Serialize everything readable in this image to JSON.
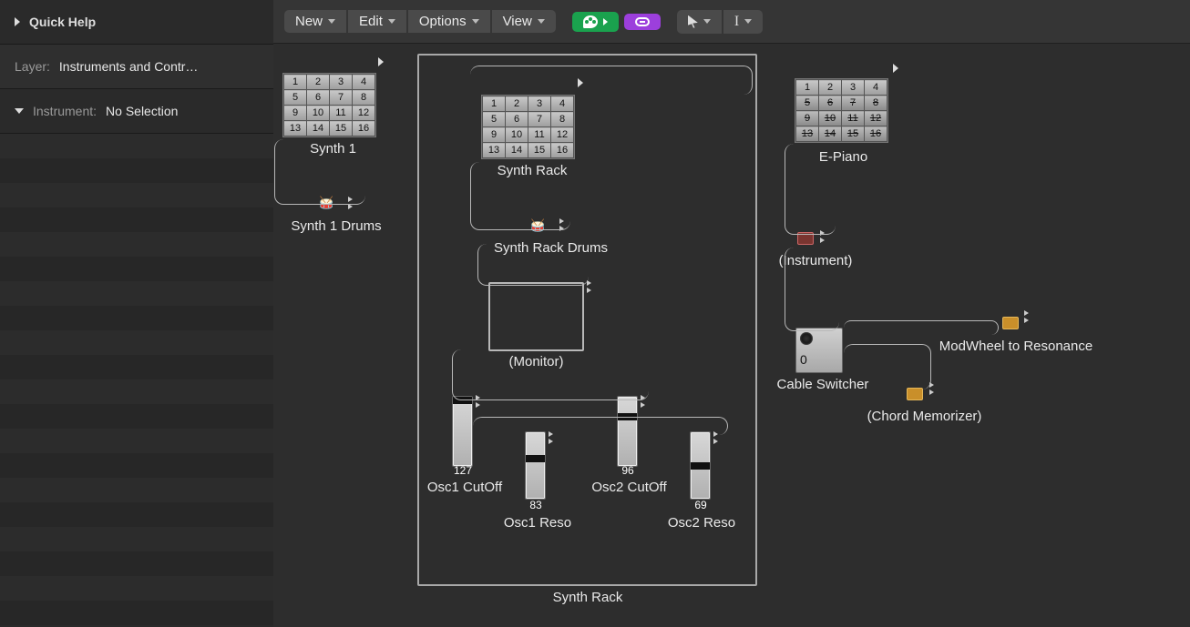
{
  "sidebar": {
    "quick_help_title": "Quick Help",
    "layer_label": "Layer:",
    "layer_value": "Instruments and Contr…",
    "instrument_label": "Instrument:",
    "instrument_value": "No Selection"
  },
  "toolbar": {
    "new": "New",
    "edit": "Edit",
    "options": "Options",
    "view": "View"
  },
  "objects": {
    "synth1": {
      "label": "Synth 1",
      "cells": [
        [
          1,
          2,
          3,
          4
        ],
        [
          5,
          6,
          7,
          8
        ],
        [
          9,
          10,
          11,
          12
        ],
        [
          13,
          14,
          15,
          16
        ]
      ]
    },
    "synth1_drums": {
      "label": "Synth 1 Drums"
    },
    "synth_rack": {
      "label": "Synth Rack",
      "cells": [
        [
          1,
          2,
          3,
          4
        ],
        [
          5,
          6,
          7,
          8
        ],
        [
          9,
          10,
          11,
          12
        ],
        [
          13,
          14,
          15,
          16
        ]
      ]
    },
    "synth_rack_drums": {
      "label": "Synth Rack Drums"
    },
    "monitor": {
      "label": "(Monitor)"
    },
    "epiano": {
      "label": "E-Piano",
      "cells": [
        [
          1,
          2,
          3,
          4
        ],
        [
          5,
          6,
          7,
          8
        ],
        [
          9,
          10,
          11,
          12
        ],
        [
          13,
          14,
          15,
          16
        ]
      ]
    },
    "instrument": {
      "label": "(Instrument)"
    },
    "cable_switcher": {
      "label": "Cable Switcher",
      "value": "0"
    },
    "modwheel": {
      "label": "ModWheel to Resonance"
    },
    "chord_mem": {
      "label": "(Chord Memorizer)"
    },
    "group_label": "Synth Rack",
    "faders": {
      "osc1_cutoff": {
        "label": "Osc1 CutOff",
        "value": "127"
      },
      "osc1_reso": {
        "label": "Osc1 Reso",
        "value": "83"
      },
      "osc2_cutoff": {
        "label": "Osc2 CutOff",
        "value": "96"
      },
      "osc2_reso": {
        "label": "Osc2 Reso",
        "value": "69"
      }
    }
  }
}
